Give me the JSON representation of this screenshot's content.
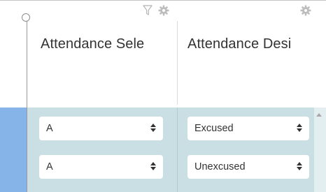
{
  "columns": [
    {
      "header": "Attendance Sele",
      "cells": [
        "A",
        "A"
      ]
    },
    {
      "header": "Attendance Desi",
      "cells": [
        "Excused",
        "Unexcused"
      ]
    }
  ],
  "icons": {
    "filter": "filter-icon",
    "column_settings": "gear-icon"
  },
  "colors": {
    "selected_row_bg": "#cadfe3",
    "row_marker": "#87b4e8"
  }
}
